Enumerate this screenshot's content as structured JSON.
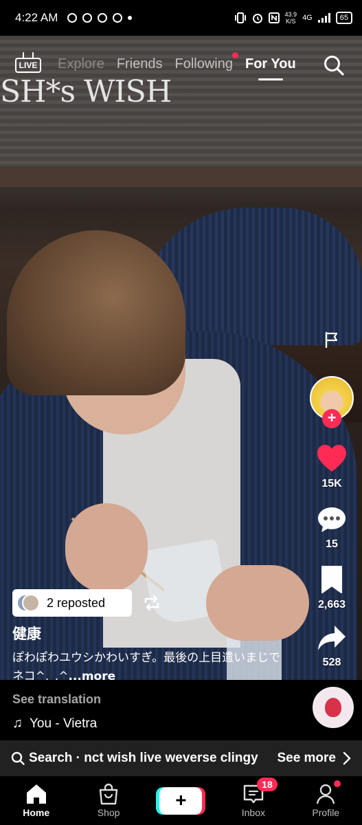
{
  "status_bar": {
    "time": "4:22 AM",
    "net_speed_value": "43.9",
    "net_speed_unit": "K/S",
    "network": "4G",
    "battery": "65"
  },
  "watermark": "SH*s WISH",
  "top_nav": {
    "live_label": "LIVE",
    "tabs": [
      {
        "label": "Explore",
        "active": false
      },
      {
        "label": "Friends",
        "active": false
      },
      {
        "label": "Following",
        "active": false,
        "has_dot": true
      },
      {
        "label": "For You",
        "active": true
      }
    ]
  },
  "rail": {
    "likes": "15K",
    "comments": "15",
    "saves": "2,663",
    "shares": "528"
  },
  "caption": {
    "repost_text": "2 reposted",
    "username": "健康",
    "description": "ぽわぽわユウシかわいすぎ。最後の上目遣いまじでネコ^._.^",
    "more_label": "...more",
    "see_translation": "See translation",
    "music": "You - Vietra"
  },
  "search_bar": {
    "query": "Search · nct wish live weverse clingy",
    "see_more": "See more"
  },
  "bottom_nav": {
    "items": [
      {
        "label": "Home",
        "icon": "home-icon",
        "active": true
      },
      {
        "label": "Shop",
        "icon": "shop-icon",
        "active": false
      },
      {
        "label": "",
        "icon": "create-icon",
        "active": false
      },
      {
        "label": "Inbox",
        "icon": "inbox-icon",
        "active": false,
        "badge": "18"
      },
      {
        "label": "Profile",
        "icon": "profile-icon",
        "active": false
      }
    ]
  },
  "colors": {
    "accent_red": "#fe2c55",
    "accent_cyan": "#25f4ee",
    "search_bar_bg": "#212121"
  }
}
